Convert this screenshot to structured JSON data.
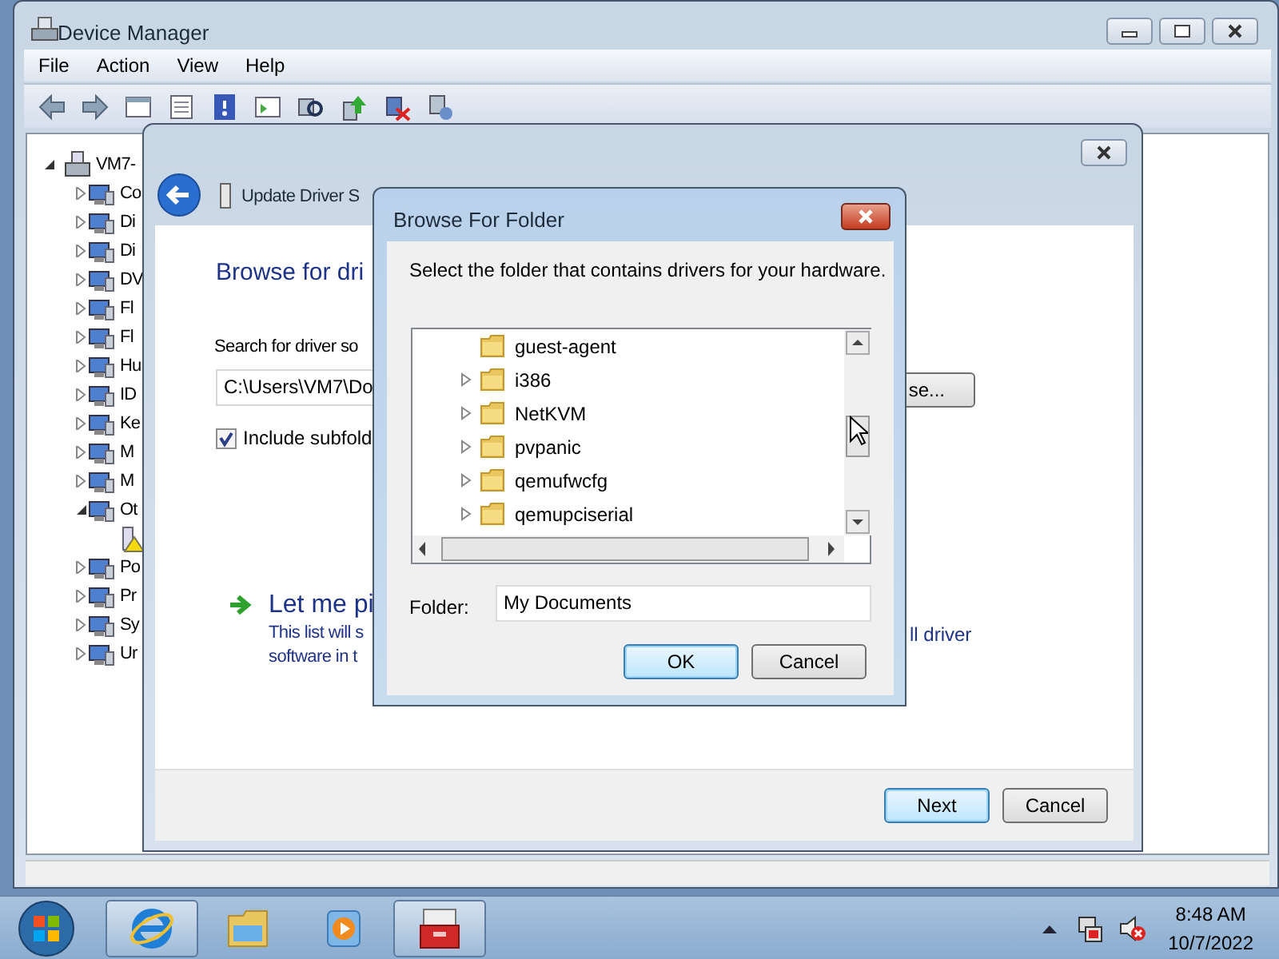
{
  "device_manager": {
    "title": "Device Manager",
    "menu": [
      "File",
      "Action",
      "View",
      "Help"
    ],
    "tree": {
      "label": "VM7-",
      "expanded": true,
      "children": [
        {
          "label": "Co",
          "expanded": false
        },
        {
          "label": "Di",
          "expanded": false
        },
        {
          "label": "Di",
          "expanded": false
        },
        {
          "label": "DV",
          "expanded": false
        },
        {
          "label": "Fl",
          "expanded": false
        },
        {
          "label": "Fl",
          "expanded": false
        },
        {
          "label": "Hu",
          "expanded": false
        },
        {
          "label": "ID",
          "expanded": false
        },
        {
          "label": "Ke",
          "expanded": false
        },
        {
          "label": "M",
          "expanded": false
        },
        {
          "label": "M",
          "expanded": false
        },
        {
          "label": "Ot",
          "expanded": true,
          "children": [
            {
              "warning": true
            }
          ]
        },
        {
          "label": "Po",
          "expanded": false
        },
        {
          "label": "Pr",
          "expanded": false
        },
        {
          "label": "Sy",
          "expanded": false
        },
        {
          "label": "Ur",
          "expanded": false
        }
      ]
    }
  },
  "wizard": {
    "heading": "Update Driver S",
    "title": "Browse for dri",
    "search_label": "Search for driver so",
    "path": "C:\\Users\\VM7\\Do",
    "browse_button": "se...",
    "include_subfolders": {
      "label": "Include subfold",
      "checked": true
    },
    "pick_title": "Let me pi",
    "pick_text": [
      "This list will s",
      "ll driver",
      "software in t"
    ],
    "buttons": [
      {
        "label": "Next",
        "default": true
      },
      {
        "label": "Cancel",
        "default": false
      }
    ]
  },
  "browse_dialog": {
    "title": "Browse For Folder",
    "instruction": "Select the folder that contains drivers for your hardware.",
    "folders": [
      {
        "label": "guest-agent",
        "has_children": false
      },
      {
        "label": "i386",
        "has_children": true
      },
      {
        "label": "NetKVM",
        "has_children": true
      },
      {
        "label": "pvpanic",
        "has_children": true
      },
      {
        "label": "qemufwcfg",
        "has_children": true
      },
      {
        "label": "qemupciserial",
        "has_children": true
      }
    ],
    "folder_label": "Folder:",
    "folder_value": "My Documents",
    "buttons": [
      {
        "label": "OK",
        "default": true
      },
      {
        "label": "Cancel",
        "default": false
      }
    ]
  },
  "taskbar": {
    "apps": [
      {
        "kind": "browser",
        "open": true
      },
      {
        "kind": "explorer",
        "open": false
      },
      {
        "kind": "media",
        "open": false
      },
      {
        "kind": "toolbox",
        "open": true
      }
    ],
    "time": "8:48 AM",
    "date": "10/7/2022"
  }
}
